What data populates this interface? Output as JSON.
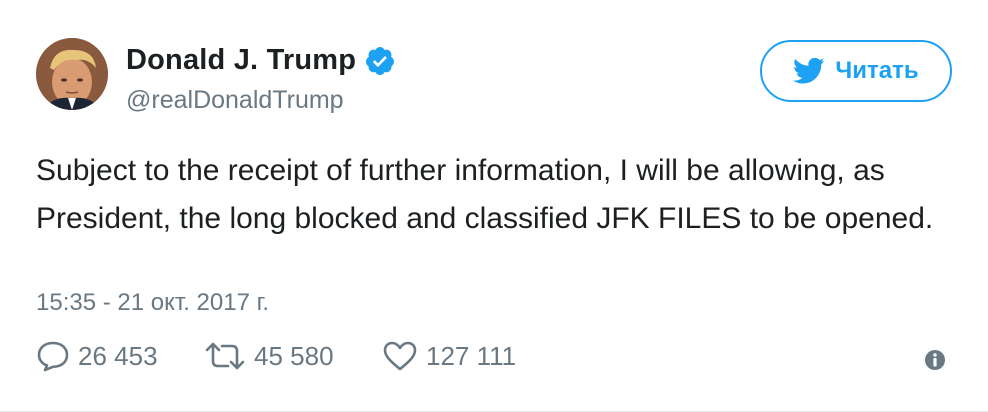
{
  "tweet": {
    "author_name": "Donald J. Trump",
    "handle": "@realDonaldTrump",
    "verified": true,
    "follow_label": "Читать",
    "text": "Subject to the receipt of further information, I will be allowing, as President, the long blocked and classified JFK FILES to be opened.",
    "timestamp": "15:35 - 21 окт. 2017 г.",
    "stats": {
      "replies": "26 453",
      "retweets": "45 580",
      "likes": "127 111"
    }
  },
  "icons": {
    "brand": "twitter-bird-icon",
    "verified": "verified-badge-icon",
    "reply": "reply-icon",
    "retweet": "retweet-icon",
    "like": "heart-icon",
    "info": "info-icon"
  },
  "colors": {
    "brand_blue": "#1da1f2",
    "text_primary": "#1c2022",
    "text_secondary": "#697882",
    "border": "#e1e8ed"
  }
}
